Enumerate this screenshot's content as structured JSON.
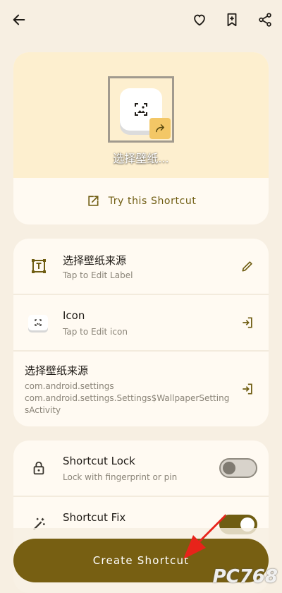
{
  "topbar": {
    "back_icon": "arrow-back-icon",
    "actions": [
      "heart-icon",
      "bookmark-add-icon",
      "share-icon"
    ]
  },
  "preview": {
    "app_name": "选择壁纸...",
    "try_label": "Try this Shortcut"
  },
  "details": {
    "label_title": "选择壁纸来源",
    "label_sub": "Tap to Edit Label",
    "icon_title": "Icon",
    "icon_sub": "Tap to Edit icon",
    "activity_title": "选择壁纸来源",
    "activity_package": "com.android.settings",
    "activity_class_line1": "com.android.settings.Settings$WallpaperSetting",
    "activity_class_line2": "sActivity"
  },
  "options": {
    "lock_title": "Shortcut Lock",
    "lock_sub": "Lock with fingerprint or pin",
    "lock_enabled": false,
    "fix_title": "Shortcut Fix",
    "fix_enabled": true
  },
  "footer": {
    "create_label": "Create Shortcut",
    "watermark": "PC768"
  },
  "colors": {
    "background": "#f7efe2",
    "accent": "#775f12",
    "hero": "#fdefcf",
    "badge": "#f3c766",
    "annotation_arrow": "#e8231a"
  }
}
